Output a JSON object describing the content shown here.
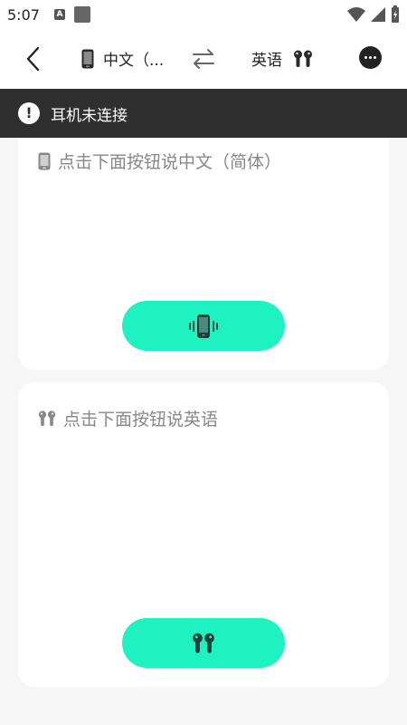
{
  "status_bar": {
    "time": "5:07",
    "notif_icon_letter": "A"
  },
  "nav": {
    "source_lang": "中文（...",
    "target_lang": "英语"
  },
  "banner": {
    "message": "耳机未连接",
    "icon_glyph": "!"
  },
  "phone_panel": {
    "prompt": "点击下面按钮说中文（简体）"
  },
  "earbuds_panel": {
    "prompt": "点击下面按钮说英语"
  },
  "colors": {
    "accent": "#1ef2c0",
    "banner_bg": "#2f2f2f",
    "page_bg": "#f6f6f6"
  },
  "icons": [
    "back-arrow-icon",
    "phone-icon",
    "swap-icon",
    "earbuds-icon",
    "more-icon",
    "alert-icon",
    "phone-vibrate-icon"
  ]
}
